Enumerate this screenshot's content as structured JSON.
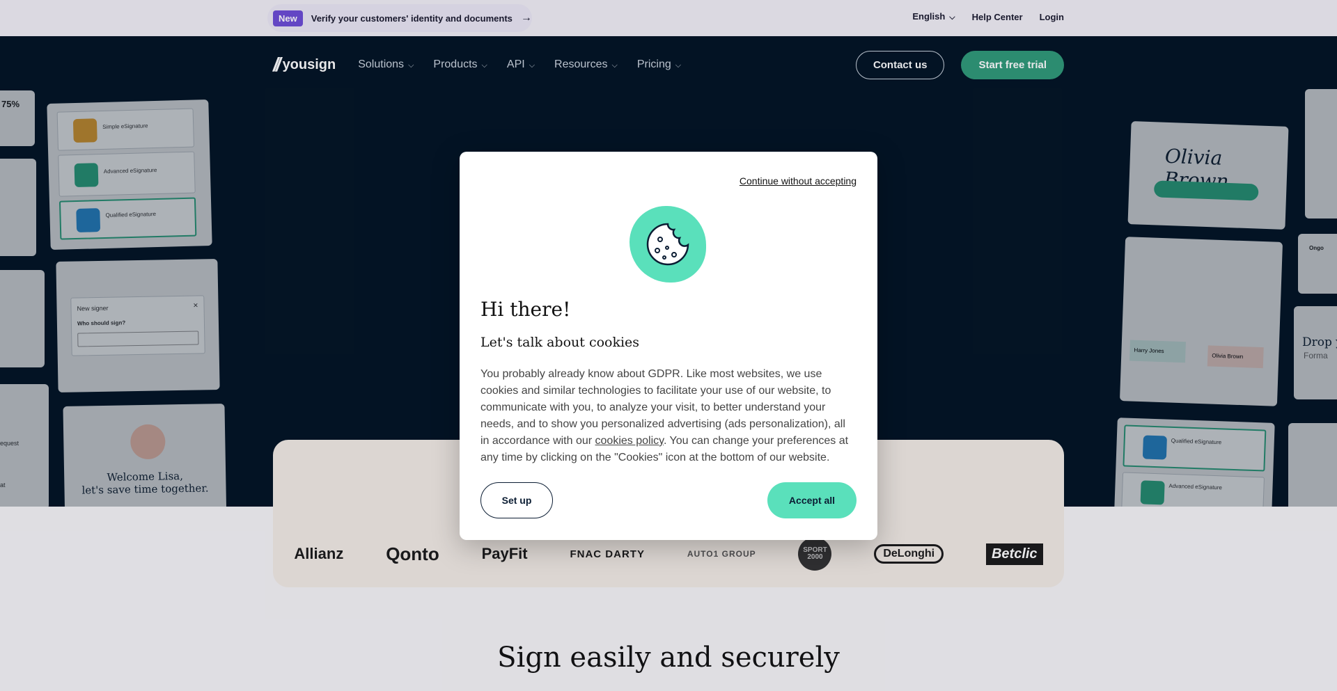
{
  "announcement": {
    "badge": "New",
    "text": "Verify your customers' identity and documents",
    "arrow_icon": "arrow-right-icon"
  },
  "top_links": {
    "language": "English",
    "help": "Help Center",
    "login": "Login"
  },
  "nav": {
    "logo_text": "yousign",
    "menu": [
      {
        "label": "Solutions"
      },
      {
        "label": "Products"
      },
      {
        "label": "API"
      },
      {
        "label": "Resources"
      },
      {
        "label": "Pricing"
      }
    ],
    "contact": "Contact us",
    "trial": "Start free trial"
  },
  "hero_cards": {
    "percent": "75%",
    "simple": "Simple eSignature",
    "advanced": "Advanced eSignature",
    "qualified": "Qualified eSignature",
    "new_signer": "New signer",
    "who_should_sign": "Who should sign?",
    "welcome_line1": "Welcome Lisa,",
    "welcome_line2": "let's save time together.",
    "signature_name": "Olivia Brown",
    "signer_a": "Harry Jones",
    "signer_b": "Olivia Brown",
    "drop": "Drop y",
    "forma": "Forma",
    "ongo": "Ongo",
    "request": "equest",
    "fragment_at": "at"
  },
  "brands": [
    "Allianz",
    "Qonto",
    "PayFit",
    "FNAC DARTY",
    "AUTO1 GROUP",
    "SPORT 2000",
    "DeLonghi",
    "Betclic"
  ],
  "section_title": "Sign easily and securely",
  "modal": {
    "continue": "Continue without accepting",
    "title": "Hi there!",
    "subtitle": "Let's talk about cookies",
    "body_before": "You probably already know about GDPR. Like most websites, we use cookies and similar technologies to facilitate your use of our website, to communicate with you, to analyze your visit, to better understand your needs, and to show you personalized advertising (ads personalization), all in accordance with our ",
    "policy_link": "cookies policy",
    "body_after": ". You can change your preferences at any time by clicking on the \"Cookies\" icon at the bottom of our website.",
    "setup": "Set up",
    "accept": "Accept all"
  },
  "colors": {
    "hero_bg": "#021424",
    "accent_green": "#2f9a79",
    "cookie_mint": "#5ae0bb",
    "badge_purple": "#6d4cd6"
  }
}
